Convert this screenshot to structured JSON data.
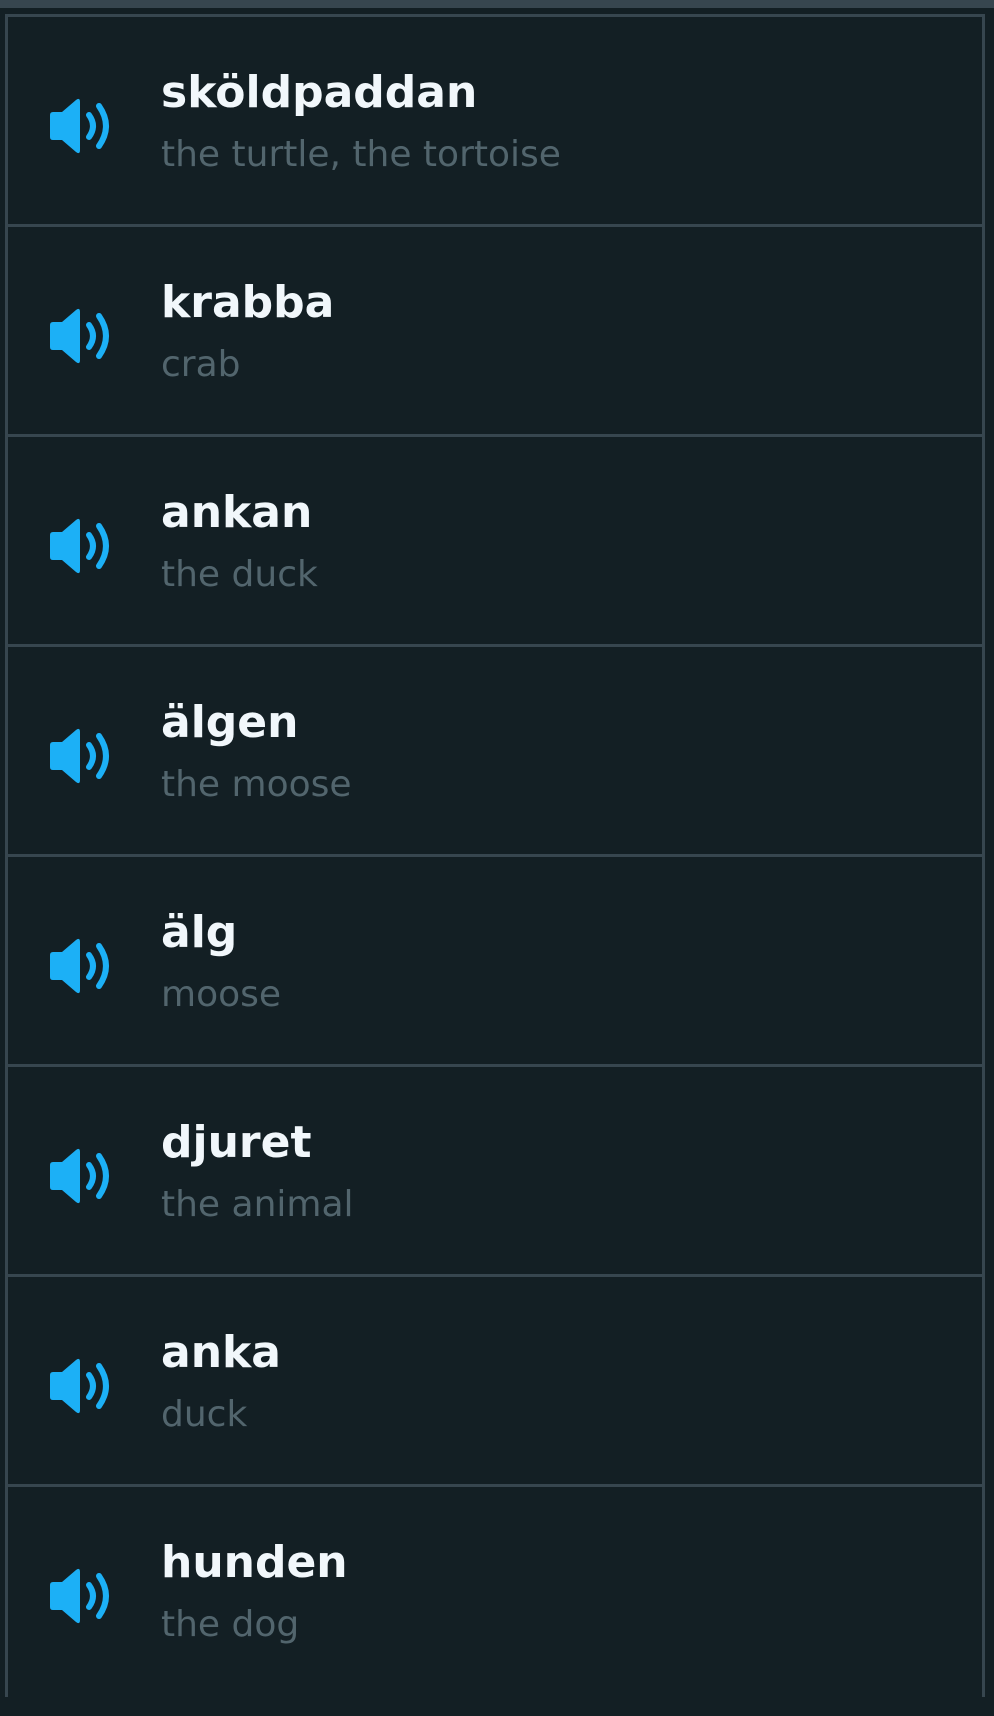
{
  "colors": {
    "background": "#131f24",
    "border": "#37464f",
    "word": "#f1f7fb",
    "translation": "#52656d",
    "speaker": "#1cb0f6"
  },
  "speaker_icon": "speaker-volume-icon",
  "words": [
    {
      "word": "sköldpaddan",
      "translation": "the turtle, the tortoise"
    },
    {
      "word": "krabba",
      "translation": "crab"
    },
    {
      "word": "ankan",
      "translation": "the duck"
    },
    {
      "word": "älgen",
      "translation": "the moose"
    },
    {
      "word": "älg",
      "translation": "moose"
    },
    {
      "word": "djuret",
      "translation": "the animal"
    },
    {
      "word": "anka",
      "translation": "duck"
    },
    {
      "word": "hunden",
      "translation": "the dog"
    }
  ]
}
